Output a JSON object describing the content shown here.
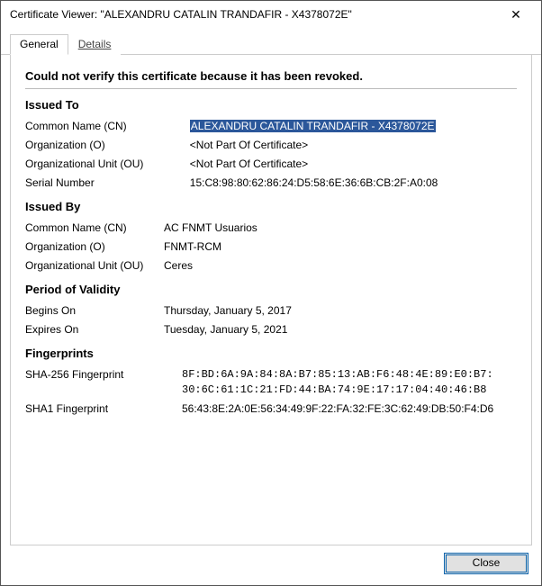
{
  "window": {
    "title": "Certificate Viewer: \"ALEXANDRU CATALIN TRANDAFIR - X4378072E\"",
    "close_glyph": "✕"
  },
  "tabs": {
    "general": "General",
    "details": "Details"
  },
  "status_message": "Could not verify this certificate because it has been revoked.",
  "sections": {
    "issued_to": {
      "title": "Issued To",
      "cn_label": "Common Name (CN)",
      "cn_value": "ALEXANDRU CATALIN TRANDAFIR - X4378072E",
      "org_label": "Organization (O)",
      "org_value": "<Not Part Of Certificate>",
      "ou_label": "Organizational Unit (OU)",
      "ou_value": "<Not Part Of Certificate>",
      "serial_label": "Serial Number",
      "serial_value": "15:C8:98:80:62:86:24:D5:58:6E:36:6B:CB:2F:A0:08"
    },
    "issued_by": {
      "title": "Issued By",
      "cn_label": "Common Name (CN)",
      "cn_value": "AC FNMT Usuarios",
      "org_label": "Organization (O)",
      "org_value": "FNMT-RCM",
      "ou_label": "Organizational Unit (OU)",
      "ou_value": "Ceres"
    },
    "validity": {
      "title": "Period of Validity",
      "begins_label": "Begins On",
      "begins_value": "Thursday, January 5, 2017",
      "expires_label": "Expires On",
      "expires_value": "Tuesday, January 5, 2021"
    },
    "fingerprints": {
      "title": "Fingerprints",
      "sha256_label": "SHA-256 Fingerprint",
      "sha256_value": "8F:BD:6A:9A:84:8A:B7:85:13:AB:F6:48:4E:89:E0:B7:\n30:6C:61:1C:21:FD:44:BA:74:9E:17:17:04:40:46:B8",
      "sha1_label": "SHA1 Fingerprint",
      "sha1_value": "56:43:8E:2A:0E:56:34:49:9F:22:FA:32:FE:3C:62:49:DB:50:F4:D6"
    }
  },
  "buttons": {
    "close": "Close"
  }
}
